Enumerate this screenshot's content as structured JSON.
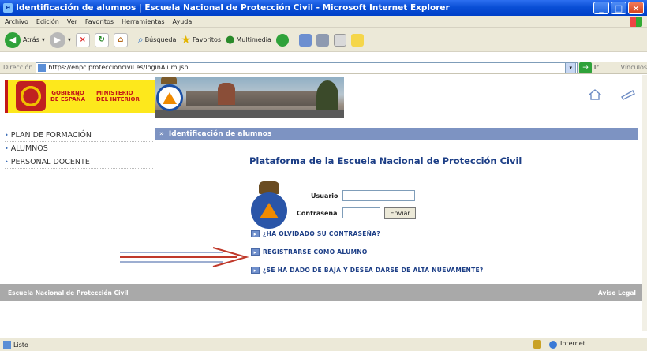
{
  "window": {
    "title": "Identificación de alumnos | Escuela Nacional de Protección Civil - Microsoft Internet Explorer"
  },
  "menu": [
    "Archivo",
    "Edición",
    "Ver",
    "Favoritos",
    "Herramientas",
    "Ayuda"
  ],
  "toolbar": {
    "back_label": "Atrás",
    "search_label": "Búsqueda",
    "favorites_label": "Favoritos",
    "media_label": "Multimedia"
  },
  "address": {
    "label": "Dirección",
    "url": "https://enpc.proteccioncivil.es/loginAlum.jsp",
    "go_label": "Ir",
    "links_label": "Vínculos"
  },
  "banner": {
    "gov_line1": "GOBIERNO",
    "gov_line2": "DE ESPAÑA",
    "min_line1": "MINISTERIO",
    "min_line2": "DEL INTERIOR"
  },
  "nav": {
    "items": [
      "PLAN DE FORMACIÓN",
      "ALUMNOS",
      "PERSONAL DOCENTE"
    ]
  },
  "section": {
    "header": "Identificación de alumnos",
    "title": "Plataforma de la Escuela Nacional de Protección Civil"
  },
  "login": {
    "user_label": "Usuario",
    "pass_label": "Contraseña",
    "submit_label": "Enviar",
    "user_value": "",
    "pass_value": ""
  },
  "links": {
    "forgot": "¿HA OLVIDADO SU CONTRASEÑA?",
    "register": "REGISTRARSE COMO ALUMNO",
    "reenroll": "¿SE HA DADO DE BAJA Y DESEA DARSE DE ALTA NUEVAMENTE?"
  },
  "footer": {
    "left": "Escuela Nacional de Protección Civil",
    "right": "Aviso Legal"
  },
  "status": {
    "text": "Listo",
    "zone": "Internet"
  },
  "colors": {
    "title_blue": "#1c3e86",
    "header_bar": "#7d93c2",
    "footer_gray": "#a9a9a9",
    "gov_yellow": "#fde81c"
  }
}
